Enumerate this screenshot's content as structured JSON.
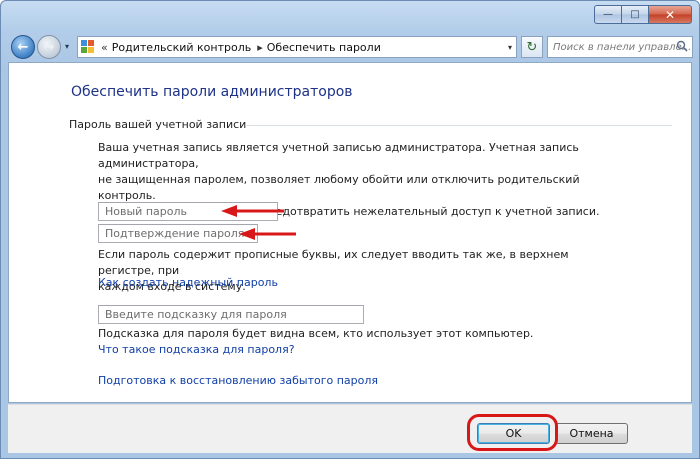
{
  "window": {
    "minimize_glyph": "—",
    "maximize_glyph": "□",
    "close_glyph": "✕"
  },
  "nav": {
    "back_glyph": "←",
    "forward_glyph": "→",
    "history_dropdown_glyph": "▾",
    "breadcrumb_lead": "«",
    "breadcrumb": [
      "Родительский контроль",
      "Обеспечить пароли"
    ],
    "breadcrumb_separator": "▸",
    "address_dropdown_glyph": "▾",
    "refresh_glyph": "↻",
    "search_placeholder": "Поиск в панели управле..."
  },
  "content": {
    "title": "Обеспечить пароли администраторов",
    "section_label": "Пароль вашей учетной записи",
    "description_lines": [
      "Ваша учетная запись является учетной записью администратора.  Учетная запись администратора,",
      "не защищенная паролем, позволяет любому обойти или отключить родительский контроль.",
      "Установка пароля поможет предотвратить нежелательный доступ к учетной записи."
    ],
    "new_password_placeholder": "Новый пароль",
    "confirm_password_placeholder": "Подтверждение пароля",
    "case_hint_lines": [
      "Если пароль содержит прописные буквы, их следует вводить так же, в верхнем регистре, при",
      "каждом входе в систему."
    ],
    "strong_password_link": "Как создать надежный пароль",
    "password_hint_placeholder": "Введите подсказку для пароля",
    "hint_visibility_note": "Подсказка для пароля будет видна всем, кто использует этот компьютер.",
    "what_is_hint_link": "Что такое подсказка для пароля?",
    "recovery_link": "Подготовка к восстановлению забытого пароля"
  },
  "footer": {
    "ok_label": "OK",
    "cancel_label": "Отмена"
  },
  "colors": {
    "title": "#1e3287",
    "link": "#0f3ea6",
    "annotation_red": "#d81818"
  }
}
